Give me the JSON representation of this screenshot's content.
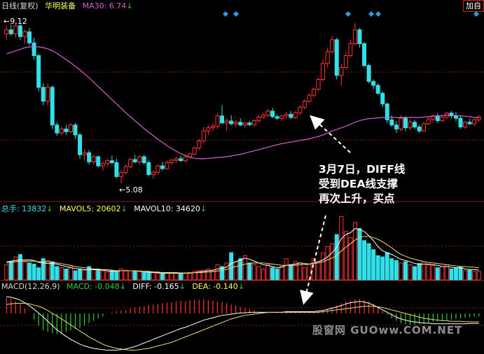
{
  "price_header": {
    "period": "日线(复权)",
    "stock_name": "华明装备",
    "ma30_label": "MA30: 6.74",
    "ma30_arrow": "↓"
  },
  "fuquan_button": "加自",
  "price_labels": {
    "high": "←9.12",
    "low": "←5.08"
  },
  "volume_header": {
    "total": "总手: 13832",
    "total_arrow": "↓",
    "mavol5": "MAVOL5: 20602",
    "mavol5_arrow": "↓",
    "mavol10": "MAVOL10: 34620",
    "mavol10_arrow": "↓"
  },
  "macd_header": {
    "name": "MACD(12,26,9)",
    "macd": "MACD: -0.048",
    "macd_arrow": "↓",
    "diff": "DIFF: -0.165",
    "diff_arrow": "↓",
    "dea": "DEA: -0.140",
    "dea_arrow": "↓"
  },
  "annotation": {
    "line1": "3月7日，DIFF线",
    "line2": "受到DEA线支撑",
    "line3": "再次上升，买点"
  },
  "watermark": "股窗网 GUOww.COM.NET",
  "colors": {
    "up": "#ff3333",
    "down": "#33e0e8",
    "ma30": "#d060d0",
    "mavol5": "#ffffff",
    "mavol10": "#e8e070",
    "diff": "#ffffff",
    "dea": "#e8e070",
    "grid": "#8b1a1a",
    "signal": "#3399dd"
  },
  "chart_data": {
    "type": "candlestick",
    "price_range": [
      5.08,
      9.12
    ],
    "candles": [
      [
        8.85,
        9.05,
        8.7,
        8.95
      ],
      [
        8.95,
        9.08,
        8.8,
        8.85
      ],
      [
        8.85,
        9.12,
        8.75,
        9.05
      ],
      [
        9.05,
        9.1,
        8.7,
        8.78
      ],
      [
        8.78,
        8.95,
        8.6,
        8.9
      ],
      [
        8.9,
        9.0,
        8.55,
        8.62
      ],
      [
        8.62,
        8.75,
        8.2,
        8.3
      ],
      [
        8.3,
        8.35,
        7.4,
        7.5
      ],
      [
        7.5,
        7.6,
        7.05,
        7.15
      ],
      [
        7.15,
        7.6,
        7.05,
        7.5
      ],
      [
        7.5,
        7.55,
        6.45,
        6.55
      ],
      [
        6.55,
        6.62,
        6.28,
        6.35
      ],
      [
        6.35,
        6.5,
        6.3,
        6.45
      ],
      [
        6.45,
        6.55,
        6.3,
        6.38
      ],
      [
        6.38,
        6.6,
        6.35,
        6.55
      ],
      [
        6.55,
        6.6,
        6.2,
        6.3
      ],
      [
        6.3,
        6.35,
        5.7,
        5.8
      ],
      [
        5.8,
        5.95,
        5.65,
        5.85
      ],
      [
        5.85,
        5.92,
        5.55,
        5.62
      ],
      [
        5.62,
        5.8,
        5.55,
        5.75
      ],
      [
        5.75,
        5.78,
        5.48,
        5.52
      ],
      [
        5.52,
        5.62,
        5.4,
        5.58
      ],
      [
        5.58,
        5.7,
        5.5,
        5.65
      ],
      [
        5.65,
        5.78,
        5.55,
        5.6
      ],
      [
        5.6,
        5.7,
        5.2,
        5.25
      ],
      [
        5.25,
        5.42,
        5.08,
        5.35
      ],
      [
        5.35,
        5.55,
        5.3,
        5.5
      ],
      [
        5.5,
        5.72,
        5.45,
        5.68
      ],
      [
        5.68,
        5.8,
        5.58,
        5.62
      ],
      [
        5.62,
        5.78,
        5.55,
        5.75
      ],
      [
        5.75,
        5.8,
        5.55,
        5.6
      ],
      [
        5.6,
        5.65,
        5.25,
        5.3
      ],
      [
        5.3,
        5.4,
        5.2,
        5.36
      ],
      [
        5.36,
        5.55,
        5.3,
        5.52
      ],
      [
        5.52,
        5.62,
        5.4,
        5.45
      ],
      [
        5.45,
        5.65,
        5.42,
        5.6
      ],
      [
        5.6,
        5.7,
        5.55,
        5.66
      ],
      [
        5.66,
        5.75,
        5.6,
        5.7
      ],
      [
        5.7,
        5.78,
        5.62,
        5.65
      ],
      [
        5.65,
        5.8,
        5.6,
        5.75
      ],
      [
        5.75,
        5.85,
        5.7,
        5.82
      ],
      [
        5.82,
        6.0,
        5.78,
        5.97
      ],
      [
        5.97,
        6.2,
        5.92,
        6.15
      ],
      [
        6.15,
        6.5,
        6.1,
        6.4
      ],
      [
        6.4,
        6.55,
        6.3,
        6.48
      ],
      [
        6.48,
        6.6,
        6.4,
        6.52
      ],
      [
        6.52,
        6.85,
        6.45,
        6.78
      ],
      [
        6.78,
        7.05,
        6.7,
        6.6
      ],
      [
        6.6,
        6.72,
        6.4,
        6.65
      ],
      [
        6.65,
        6.8,
        6.55,
        6.58
      ],
      [
        6.58,
        6.68,
        6.5,
        6.62
      ],
      [
        6.62,
        6.72,
        6.52,
        6.55
      ],
      [
        6.55,
        6.62,
        6.48,
        6.6
      ],
      [
        6.6,
        6.65,
        6.52,
        6.56
      ],
      [
        6.56,
        6.7,
        6.5,
        6.66
      ],
      [
        6.66,
        6.8,
        6.6,
        6.75
      ],
      [
        6.75,
        6.85,
        6.7,
        6.8
      ],
      [
        6.8,
        6.95,
        6.75,
        6.9
      ],
      [
        6.9,
        6.98,
        6.72,
        6.76
      ],
      [
        6.76,
        6.82,
        6.68,
        6.72
      ],
      [
        6.72,
        6.8,
        6.65,
        6.78
      ],
      [
        6.78,
        6.88,
        6.7,
        6.82
      ],
      [
        6.82,
        6.9,
        6.7,
        6.74
      ],
      [
        6.74,
        6.9,
        6.7,
        6.86
      ],
      [
        6.86,
        7.05,
        6.8,
        7.0
      ],
      [
        7.0,
        7.2,
        6.95,
        7.15
      ],
      [
        7.15,
        7.35,
        7.1,
        7.3
      ],
      [
        7.3,
        7.5,
        7.25,
        7.45
      ],
      [
        7.45,
        7.75,
        7.4,
        7.7
      ],
      [
        7.7,
        8.2,
        7.65,
        8.1
      ],
      [
        8.1,
        8.5,
        8.0,
        8.4
      ],
      [
        8.4,
        8.8,
        8.35,
        8.7
      ],
      [
        8.7,
        8.75,
        7.7,
        7.8
      ],
      [
        7.8,
        8.1,
        7.55,
        8.0
      ],
      [
        8.0,
        8.4,
        7.95,
        8.3
      ],
      [
        8.3,
        8.7,
        8.25,
        8.6
      ],
      [
        8.6,
        9.12,
        8.55,
        8.95
      ],
      [
        8.95,
        9.0,
        8.5,
        8.6
      ],
      [
        8.6,
        8.65,
        8.0,
        8.05
      ],
      [
        8.05,
        8.1,
        7.6,
        7.65
      ],
      [
        7.65,
        7.7,
        7.45,
        7.55
      ],
      [
        7.55,
        7.6,
        7.3,
        7.35
      ],
      [
        7.35,
        7.4,
        7.0,
        7.08
      ],
      [
        7.08,
        7.12,
        6.6,
        6.68
      ],
      [
        6.68,
        6.8,
        6.5,
        6.55
      ],
      [
        6.55,
        6.65,
        6.35,
        6.45
      ],
      [
        6.45,
        6.8,
        6.4,
        6.72
      ],
      [
        6.72,
        6.78,
        6.4,
        6.48
      ],
      [
        6.48,
        6.7,
        6.42,
        6.62
      ],
      [
        6.62,
        6.68,
        6.45,
        6.5
      ],
      [
        6.5,
        6.55,
        6.35,
        6.4
      ],
      [
        6.4,
        6.62,
        6.38,
        6.58
      ],
      [
        6.58,
        6.75,
        6.55,
        6.7
      ],
      [
        6.7,
        6.82,
        6.62,
        6.78
      ],
      [
        6.78,
        6.85,
        6.6,
        6.66
      ],
      [
        6.66,
        6.8,
        6.62,
        6.75
      ],
      [
        6.75,
        6.88,
        6.7,
        6.85
      ],
      [
        6.85,
        6.9,
        6.72,
        6.78
      ],
      [
        6.78,
        6.88,
        6.65,
        6.72
      ],
      [
        6.72,
        6.8,
        6.45,
        6.5
      ],
      [
        6.5,
        6.66,
        6.45,
        6.62
      ],
      [
        6.62,
        6.7,
        6.55,
        6.58
      ],
      [
        6.58,
        6.72,
        6.52,
        6.68
      ],
      [
        6.68,
        6.8,
        6.62,
        6.75
      ]
    ],
    "ma30": [
      8.35,
      8.38,
      8.42,
      8.46,
      8.5,
      8.52,
      8.53,
      8.52,
      8.5,
      8.47,
      8.42,
      8.36,
      8.28,
      8.2,
      8.12,
      8.03,
      7.94,
      7.84,
      7.74,
      7.63,
      7.52,
      7.41,
      7.3,
      7.19,
      7.08,
      6.97,
      6.86,
      6.76,
      6.66,
      6.56,
      6.46,
      6.37,
      6.28,
      6.19,
      6.11,
      6.03,
      5.96,
      5.89,
      5.83,
      5.78,
      5.74,
      5.71,
      5.7,
      5.7,
      5.71,
      5.72,
      5.73,
      5.74,
      5.75,
      5.77,
      5.79,
      5.81,
      5.84,
      5.87,
      5.9,
      5.93,
      5.96,
      5.99,
      6.02,
      6.05,
      6.08,
      6.1,
      6.12,
      6.14,
      6.16,
      6.18,
      6.2,
      6.23,
      6.26,
      6.3,
      6.35,
      6.4,
      6.44,
      6.48,
      6.52,
      6.57,
      6.62,
      6.66,
      6.69,
      6.71,
      6.72,
      6.73,
      6.74,
      6.74,
      6.74,
      6.74,
      6.74,
      6.74,
      6.74,
      6.74,
      6.74,
      6.75,
      6.76,
      6.77,
      6.78,
      6.79,
      6.8,
      6.8,
      6.79,
      6.78,
      6.77,
      6.76,
      6.74,
      6.74
    ],
    "volume_range": [
      0,
      110000
    ],
    "volume": [
      25000,
      30000,
      38000,
      42000,
      30000,
      28000,
      26000,
      20000,
      35000,
      32000,
      30000,
      22000,
      20000,
      18000,
      22000,
      15000,
      18000,
      16000,
      22000,
      17000,
      16000,
      15000,
      13000,
      15000,
      14000,
      18000,
      16000,
      15000,
      14000,
      15000,
      12000,
      13000,
      12000,
      11000,
      10000,
      12000,
      11000,
      12000,
      10000,
      11000,
      12000,
      14000,
      15000,
      16000,
      18000,
      15000,
      25000,
      22000,
      28000,
      45000,
      30000,
      35000,
      40000,
      28000,
      25000,
      22000,
      18000,
      25000,
      20000,
      18000,
      22000,
      35000,
      25000,
      30000,
      28000,
      20000,
      26000,
      35000,
      30000,
      45000,
      55000,
      60000,
      75000,
      105000,
      80000,
      70000,
      95000,
      85000,
      65000,
      60000,
      50000,
      40000,
      38000,
      45000,
      35000,
      32000,
      28000,
      30000,
      25000,
      22000,
      27000,
      30000,
      25000,
      24000,
      20000,
      22000,
      25000,
      18000,
      20000,
      22000,
      15000,
      16000,
      14000,
      13832
    ],
    "mavol5": [
      30000,
      31000,
      32000,
      33000,
      33000,
      33000,
      32000,
      29000,
      28000,
      27000,
      27000,
      26000,
      24000,
      22000,
      20000,
      19000,
      18000,
      17000,
      17000,
      17000,
      17000,
      16000,
      15000,
      14000,
      14000,
      15000,
      15000,
      15000,
      15000,
      14000,
      13000,
      13000,
      12000,
      12000,
      11000,
      11000,
      11000,
      11000,
      11000,
      11000,
      11000,
      12000,
      13000,
      14000,
      15000,
      16000,
      18000,
      19000,
      21000,
      27000,
      30000,
      33000,
      36000,
      34000,
      31000,
      28000,
      25000,
      24000,
      22000,
      20000,
      21000,
      24000,
      25000,
      26000,
      28000,
      27000,
      26000,
      28000,
      30000,
      33000,
      38000,
      45000,
      54000,
      68000,
      75000,
      78000,
      85000,
      83000,
      80000,
      73000,
      65000,
      55000,
      48000,
      45000,
      42000,
      38000,
      34000,
      32000,
      30000,
      27000,
      26000,
      26000,
      26000,
      25000,
      24000,
      22000,
      22000,
      21000,
      20000,
      20000,
      18000,
      17000,
      17000,
      16000
    ],
    "mavol10": [
      28000,
      29000,
      30000,
      31000,
      31000,
      31000,
      31000,
      30000,
      30000,
      30000,
      29000,
      28000,
      27000,
      25000,
      24000,
      22000,
      21000,
      20000,
      19000,
      18000,
      18000,
      17000,
      17000,
      16000,
      15000,
      15000,
      15000,
      15000,
      15000,
      14000,
      14000,
      14000,
      13000,
      13000,
      12000,
      12000,
      12000,
      12000,
      11500,
      11500,
      11500,
      12000,
      12000,
      12500,
      13000,
      13500,
      14500,
      16000,
      17000,
      20000,
      22000,
      24000,
      26000,
      27000,
      28000,
      28000,
      28000,
      27000,
      26000,
      25000,
      24000,
      24000,
      24000,
      24000,
      25000,
      25000,
      26000,
      27000,
      28000,
      30000,
      33000,
      36000,
      40000,
      48000,
      54000,
      60000,
      66000,
      70000,
      72000,
      72000,
      70000,
      67000,
      63000,
      58000,
      53000,
      47000,
      42000,
      39000,
      36000,
      34000,
      32000,
      30000,
      29000,
      28000,
      27000,
      26000,
      25000,
      24000,
      23000,
      22000,
      22000,
      21000,
      21000,
      20000
    ],
    "macd_range": [
      -0.65,
      0.35
    ],
    "macd": [
      0.26,
      0.24,
      0.2,
      0.16,
      0.08,
      0.0,
      -0.1,
      -0.2,
      -0.28,
      -0.3,
      -0.33,
      -0.34,
      -0.33,
      -0.3,
      -0.28,
      -0.26,
      -0.24,
      -0.2,
      -0.16,
      -0.12,
      -0.08,
      -0.05,
      0.0,
      0.02,
      0.04,
      0.05,
      0.06,
      0.08,
      0.1,
      0.11,
      0.12,
      0.14,
      0.15,
      0.16,
      0.17,
      0.18,
      0.19,
      0.2,
      0.21,
      0.2,
      0.22,
      0.23,
      0.23,
      0.24,
      0.22,
      0.21,
      0.2,
      0.19,
      0.17,
      0.15,
      0.13,
      0.11,
      0.09,
      0.07,
      0.05,
      0.03,
      0.01,
      -0.01,
      0.0,
      0.01,
      0.01,
      0.02,
      0.02,
      0.02,
      0.02,
      0.02,
      0.02,
      0.02,
      0.03,
      0.04,
      0.07,
      0.1,
      0.13,
      0.17,
      0.2,
      0.22,
      0.24,
      0.24,
      0.22,
      0.2,
      0.16,
      0.1,
      0.04,
      -0.02,
      -0.08,
      -0.12,
      -0.16,
      -0.18,
      -0.19,
      -0.19,
      -0.18,
      -0.17,
      -0.15,
      -0.14,
      -0.13,
      -0.12,
      -0.11,
      -0.1,
      -0.09,
      -0.08,
      -0.07,
      -0.06,
      -0.05,
      -0.048
    ],
    "diff": [
      0.28,
      0.27,
      0.25,
      0.22,
      0.18,
      0.13,
      0.07,
      0.01,
      -0.06,
      -0.13,
      -0.2,
      -0.27,
      -0.33,
      -0.38,
      -0.43,
      -0.47,
      -0.51,
      -0.54,
      -0.56,
      -0.58,
      -0.59,
      -0.6,
      -0.61,
      -0.61,
      -0.61,
      -0.6,
      -0.59,
      -0.57,
      -0.55,
      -0.52,
      -0.49,
      -0.46,
      -0.43,
      -0.4,
      -0.37,
      -0.34,
      -0.31,
      -0.28,
      -0.25,
      -0.23,
      -0.2,
      -0.17,
      -0.14,
      -0.11,
      -0.09,
      -0.07,
      -0.05,
      -0.03,
      -0.02,
      -0.01,
      0.0,
      0.01,
      0.01,
      0.02,
      0.02,
      0.02,
      0.02,
      0.02,
      0.02,
      0.02,
      0.02,
      0.03,
      0.03,
      0.03,
      0.03,
      0.03,
      0.03,
      0.03,
      0.04,
      0.05,
      0.07,
      0.09,
      0.11,
      0.13,
      0.16,
      0.18,
      0.19,
      0.2,
      0.19,
      0.17,
      0.14,
      0.1,
      0.06,
      0.02,
      -0.02,
      -0.06,
      -0.09,
      -0.11,
      -0.13,
      -0.14,
      -0.15,
      -0.16,
      -0.16,
      -0.17,
      -0.17,
      -0.17,
      -0.17,
      -0.17,
      -0.17,
      -0.17,
      -0.17,
      -0.166,
      -0.165,
      -0.165
    ],
    "dea": [
      0.15,
      0.16,
      0.17,
      0.17,
      0.17,
      0.16,
      0.14,
      0.12,
      0.09,
      0.05,
      0.0,
      -0.04,
      -0.09,
      -0.14,
      -0.19,
      -0.24,
      -0.29,
      -0.34,
      -0.39,
      -0.43,
      -0.47,
      -0.51,
      -0.54,
      -0.56,
      -0.58,
      -0.59,
      -0.6,
      -0.61,
      -0.61,
      -0.6,
      -0.59,
      -0.58,
      -0.56,
      -0.54,
      -0.52,
      -0.5,
      -0.48,
      -0.45,
      -0.42,
      -0.39,
      -0.36,
      -0.33,
      -0.3,
      -0.27,
      -0.24,
      -0.21,
      -0.18,
      -0.15,
      -0.12,
      -0.09,
      -0.07,
      -0.05,
      -0.03,
      -0.02,
      -0.01,
      0.0,
      0.01,
      0.02,
      0.02,
      0.02,
      0.02,
      0.02,
      0.02,
      0.02,
      0.02,
      0.02,
      0.02,
      0.02,
      0.02,
      0.03,
      0.04,
      0.05,
      0.06,
      0.07,
      0.08,
      0.09,
      0.1,
      0.11,
      0.12,
      0.12,
      0.12,
      0.11,
      0.1,
      0.08,
      0.06,
      0.04,
      0.02,
      0.0,
      -0.02,
      -0.04,
      -0.06,
      -0.08,
      -0.09,
      -0.1,
      -0.11,
      -0.12,
      -0.12,
      -0.13,
      -0.13,
      -0.13,
      -0.135,
      -0.138,
      -0.14,
      -0.14
    ],
    "signal_markers": [
      107,
      115,
      167,
      175,
      177
    ]
  }
}
